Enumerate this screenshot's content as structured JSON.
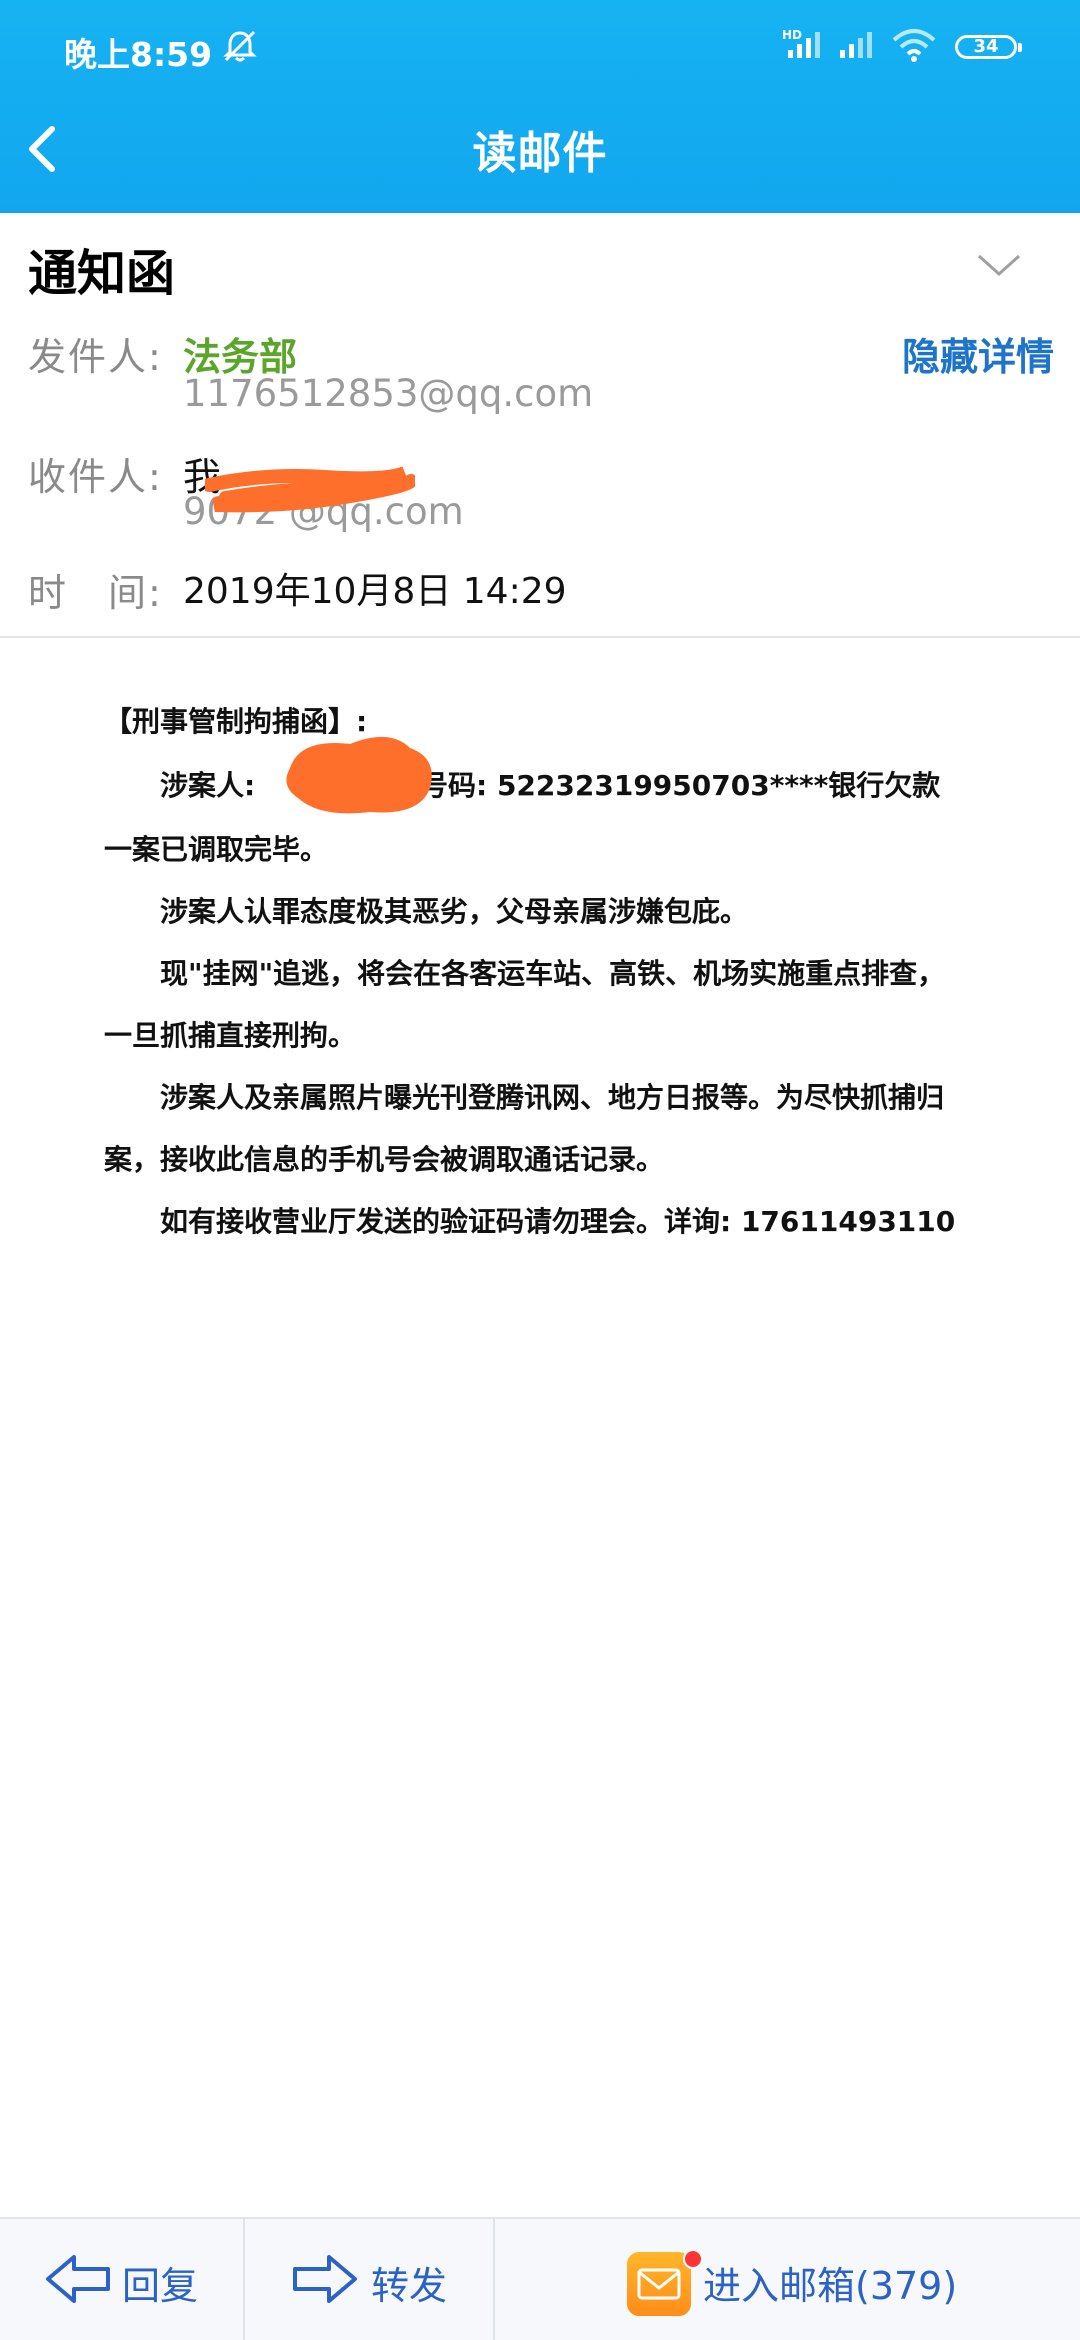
{
  "status_bar": {
    "time": "晚上8:59",
    "network_badge": "HD",
    "battery_level": "34"
  },
  "nav": {
    "title": "读邮件"
  },
  "email": {
    "subject": "通知函",
    "hide_details_label": "隐藏详情",
    "sender_label": "发件人:",
    "sender_name": "法务部",
    "sender_email": "1176512853@qq.com",
    "recipient_label": "收件人:",
    "recipient_name": "我",
    "recipient_email": "9072 @qq.com",
    "time_label": "时　间:",
    "time_value": "2019年10月8日 14:29"
  },
  "body_image_text": {
    "heading": "【刑事管制拘捕函】:",
    "line1_prefix": "涉案人:",
    "line1_suffix": "号码: 52232319950703****银行欠款",
    "line2": "一案已调取完毕。",
    "line3": "涉案人认罪态度极其恶劣，父母亲属涉嫌包庇。",
    "line4": "现\"挂网\"追逃，将会在各客运车站、高铁、机场实施重点排查，",
    "line5": "一旦抓捕直接刑拘。",
    "line6": "涉案人及亲属照片曝光刊登腾讯网、地方日报等。为尽快抓捕归",
    "line7": "案，接收此信息的手机号会被调取通话记录。",
    "line8": "如有接收营业厅发送的验证码请勿理会。详询: 17611493110"
  },
  "bottom_bar": {
    "reply_label": "回复",
    "forward_label": "转发",
    "inbox_label": "进入邮箱(379)"
  },
  "colors": {
    "header_blue": "#12a6ee",
    "sender_green": "#5aa52a",
    "link_blue": "#1d74c9",
    "redaction_orange": "#ff6f2c"
  }
}
